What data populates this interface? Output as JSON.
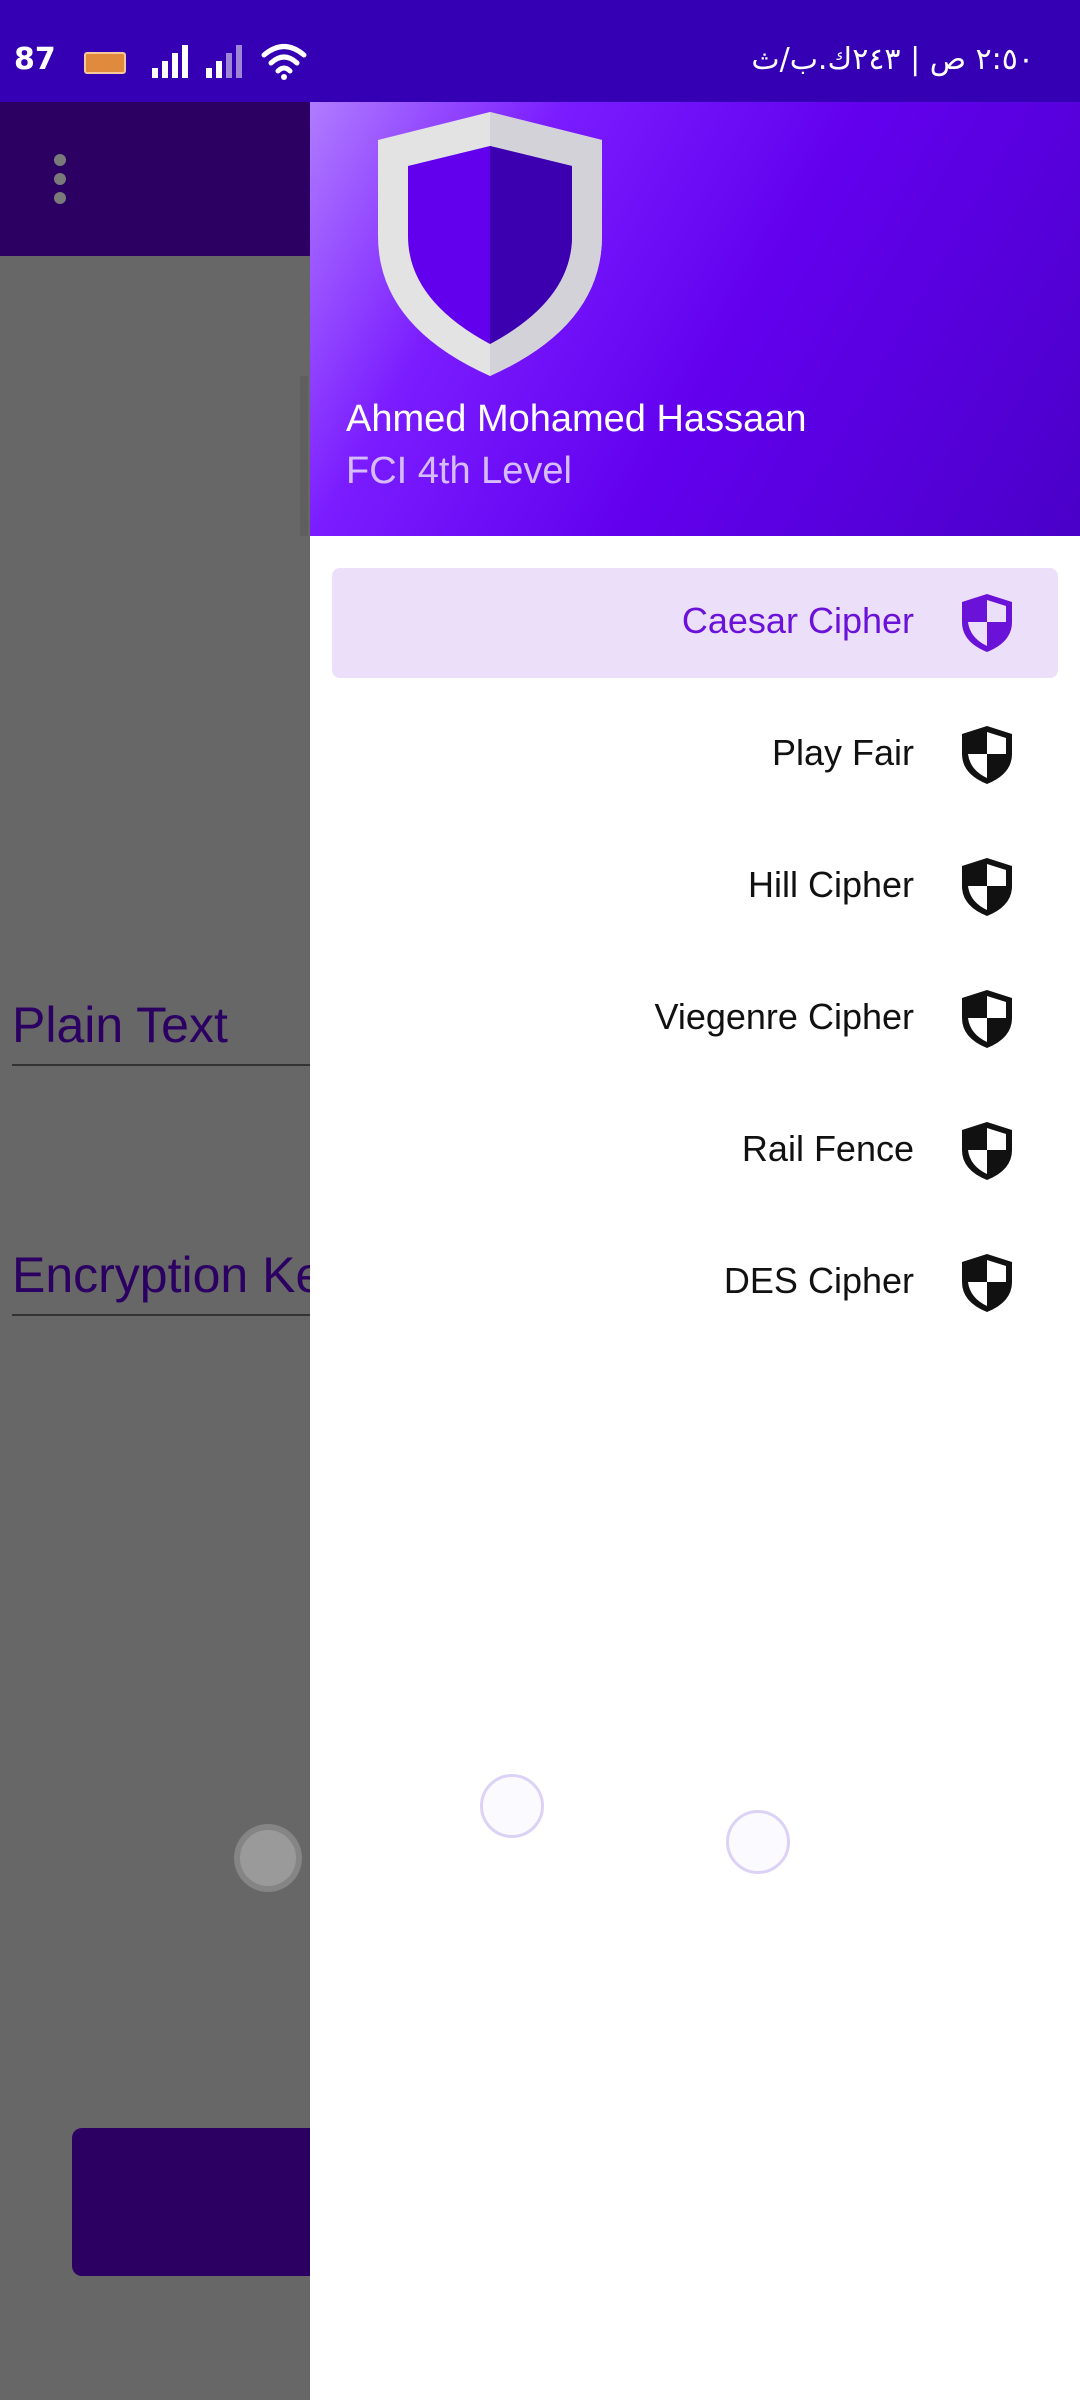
{
  "status_bar": {
    "battery_text": "87",
    "right_text": "٢:٥٠ ص | ٢٤٣ك.ب/ث"
  },
  "background_app": {
    "plain_text_label": "Plain Text",
    "key_label": "Encryption Ke"
  },
  "drawer": {
    "user_name": "Ahmed Mohamed Hassaan",
    "user_level": "FCI 4th Level",
    "items": [
      {
        "label": "Caesar Cipher",
        "icon": "shield-icon",
        "active": true
      },
      {
        "label": "Play Fair",
        "icon": "shield-icon",
        "active": false
      },
      {
        "label": "Hill Cipher",
        "icon": "shield-icon",
        "active": false
      },
      {
        "label": "Viegenre Cipher",
        "icon": "shield-icon",
        "active": false
      },
      {
        "label": "Rail Fence",
        "icon": "shield-icon",
        "active": false
      },
      {
        "label": "DES Cipher",
        "icon": "shield-icon",
        "active": false
      }
    ]
  },
  "colors": {
    "primary": "#6200ee",
    "primary_dark": "#3500b3",
    "app_bar": "#2b0062",
    "active_item_bg": "#ecdffa",
    "active_item_text": "#6b12d9"
  }
}
